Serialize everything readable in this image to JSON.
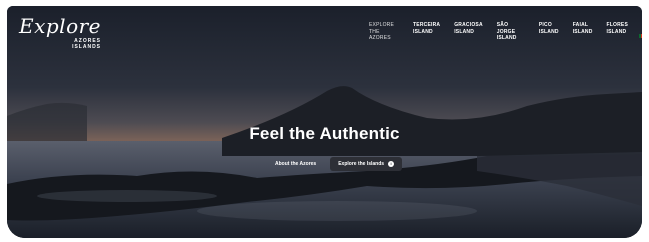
{
  "logo": {
    "script": "Explore",
    "sub_line1": "AZORES",
    "sub_line2": "ISLANDS"
  },
  "nav": [
    {
      "line1": "EXPLORE",
      "line2": "THE AZORES",
      "style": "light"
    },
    {
      "line1": "TERCEIRA",
      "line2": "ISLAND",
      "style": "bold"
    },
    {
      "line1": "GRACIOSA",
      "line2": "ISLAND",
      "style": "bold"
    },
    {
      "line1": "SÃO JORGE",
      "line2": "ISLAND",
      "style": "bold"
    },
    {
      "line1": "PICO",
      "line2": "ISLAND",
      "style": "bold"
    },
    {
      "line1": "FAIAL",
      "line2": "ISLAND",
      "style": "bold"
    },
    {
      "line1": "FLORES",
      "line2": "ISLAND",
      "style": "bold"
    }
  ],
  "language_flag": {
    "colors": [
      "#0b6b2f",
      "#d52b1e"
    ]
  },
  "hero": {
    "headline": "Feel the Authentic"
  },
  "cta": {
    "about": "About the Azores",
    "explore": "Explore the Islands",
    "explore_icon": "info-icon"
  }
}
